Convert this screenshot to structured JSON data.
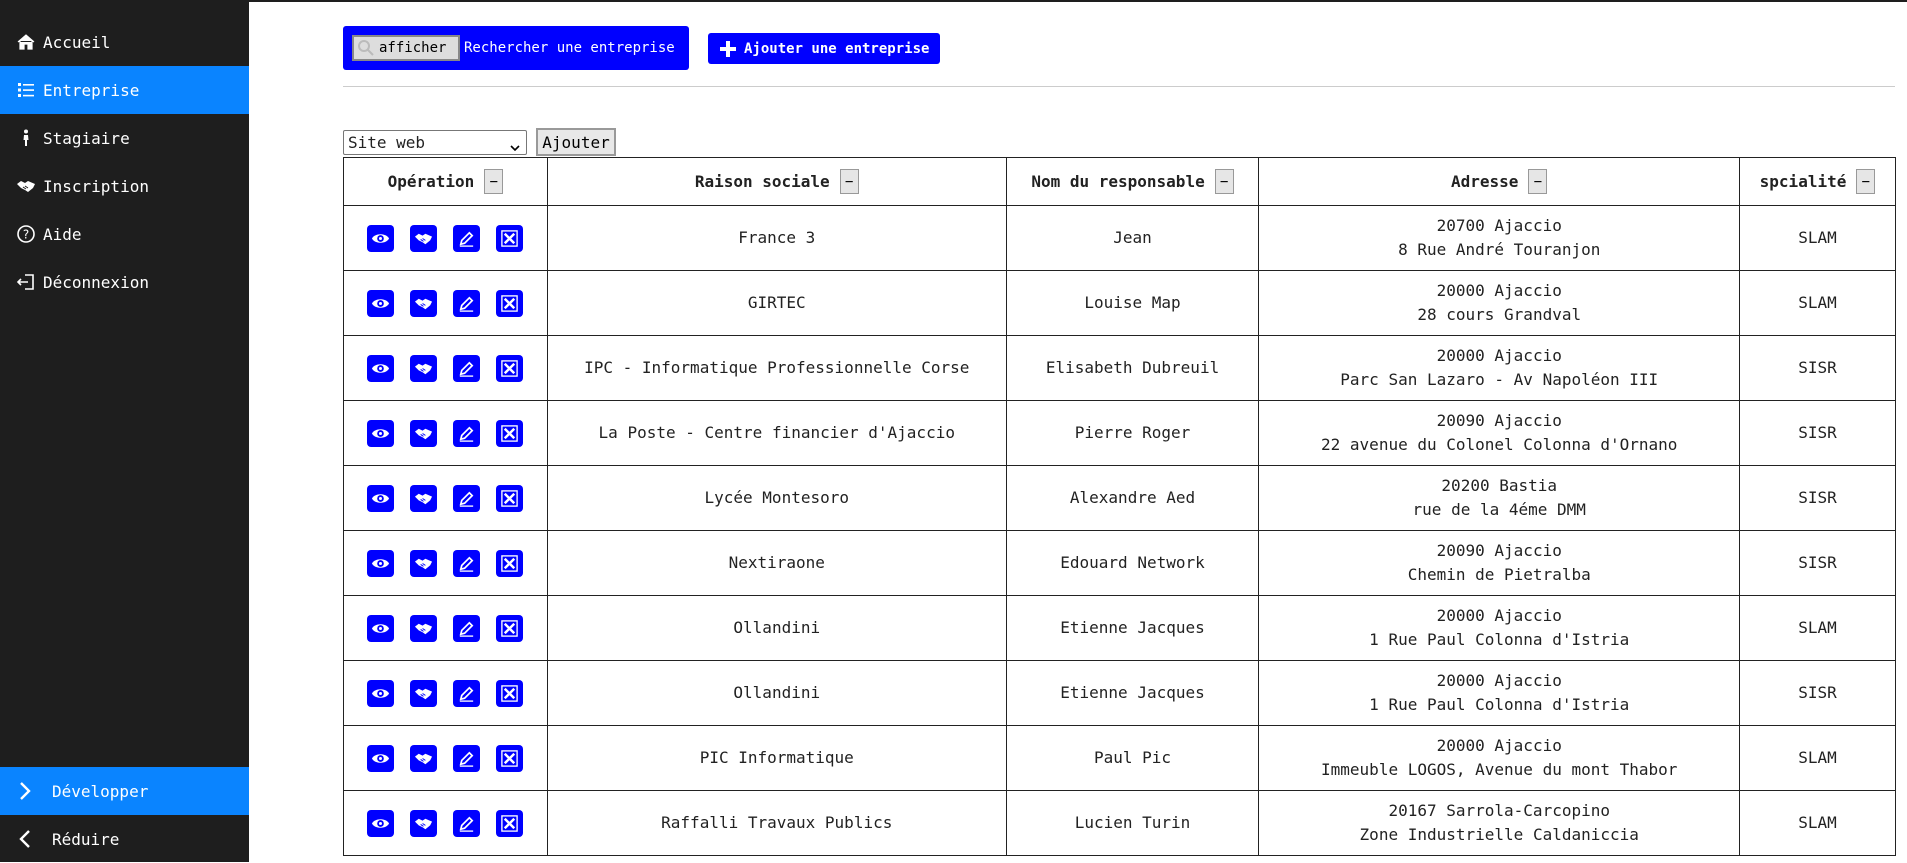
{
  "sidebar": {
    "items": [
      {
        "label": "Accueil",
        "icon": "home-icon"
      },
      {
        "label": "Entreprise",
        "icon": "list-icon",
        "active": true
      },
      {
        "label": "Stagiaire",
        "icon": "person-icon"
      },
      {
        "label": "Inscription",
        "icon": "handshake-icon"
      },
      {
        "label": "Aide",
        "icon": "help-icon"
      },
      {
        "label": "Déconnexion",
        "icon": "logout-icon"
      }
    ],
    "expand_label": "Développer",
    "collapse_label": "Réduire"
  },
  "toolbar": {
    "search_button_label": "afficher",
    "search_placeholder": "Rechercher une entreprise",
    "add_company_label": "Ajouter une entreprise"
  },
  "columns_picker": {
    "selected": "Site web",
    "add_label": "Ajouter"
  },
  "table": {
    "headers": [
      "Opération",
      "Raison sociale",
      "Nom du responsable",
      "Adresse",
      "spcialité"
    ],
    "remove_col_label": "−",
    "rows": [
      {
        "raison": "France 3",
        "responsable": "Jean",
        "adresse1": "20700 Ajaccio",
        "adresse2": "8 Rue André Touranjon",
        "specialite": "SLAM"
      },
      {
        "raison": "GIRTEC",
        "responsable": "Louise Map",
        "adresse1": "20000 Ajaccio",
        "adresse2": "28 cours Grandval",
        "specialite": "SLAM"
      },
      {
        "raison": "IPC - Informatique Professionnelle Corse",
        "responsable": "Elisabeth Dubreuil",
        "adresse1": "20000 Ajaccio",
        "adresse2": "Parc San Lazaro - Av Napoléon III",
        "specialite": "SISR"
      },
      {
        "raison": "La Poste - Centre financier d'Ajaccio",
        "responsable": "Pierre Roger",
        "adresse1": "20090 Ajaccio",
        "adresse2": "22 avenue du Colonel Colonna d'Ornano",
        "specialite": "SISR"
      },
      {
        "raison": "Lycée Montesoro",
        "responsable": "Alexandre Aed",
        "adresse1": "20200 Bastia",
        "adresse2": "rue de la 4éme DMM",
        "specialite": "SISR"
      },
      {
        "raison": "Nextiraone",
        "responsable": "Edouard Network",
        "adresse1": "20090 Ajaccio",
        "adresse2": "Chemin de Pietralba",
        "specialite": "SISR"
      },
      {
        "raison": "Ollandini",
        "responsable": "Etienne Jacques",
        "adresse1": "20000 Ajaccio",
        "adresse2": "1 Rue Paul Colonna d'Istria",
        "specialite": "SLAM"
      },
      {
        "raison": "Ollandini",
        "responsable": "Etienne Jacques",
        "adresse1": "20000 Ajaccio",
        "adresse2": "1 Rue Paul Colonna d'Istria",
        "specialite": "SISR"
      },
      {
        "raison": "PIC Informatique",
        "responsable": "Paul Pic",
        "adresse1": "20000 Ajaccio",
        "adresse2": "Immeuble LOGOS, Avenue du mont Thabor",
        "specialite": "SLAM"
      },
      {
        "raison": "Raffalli Travaux Publics",
        "responsable": "Lucien Turin",
        "adresse1": "20167 Sarrola-Carcopino",
        "adresse2": "Zone Industrielle Caldaniccia",
        "specialite": "SLAM"
      }
    ],
    "row_actions": [
      "view-icon",
      "handshake-icon",
      "edit-icon",
      "delete-icon"
    ]
  },
  "colors": {
    "sidebar_bg": "#1e1e1e",
    "accent": "#0a84ff",
    "action_blue": "#0000ff"
  }
}
